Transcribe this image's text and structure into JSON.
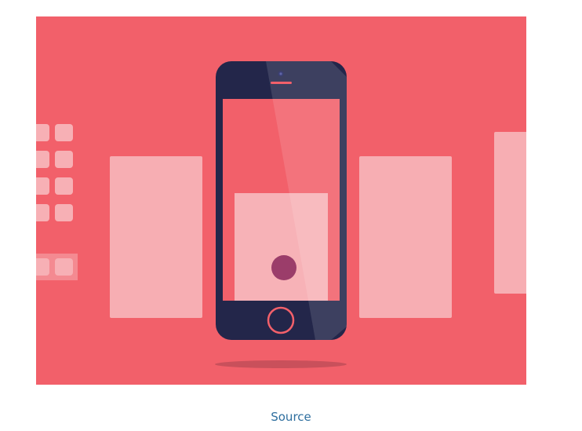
{
  "figure": {
    "colors": {
      "background": "#f2606a",
      "card": "#f7aeb3",
      "phone_body": "#23264a",
      "phone_screen": "#f2606a",
      "home_ring": "#f2606a",
      "touch_dot": "#9b3d6a",
      "shadow": "#c24e58"
    },
    "icon": "phone-swipe-illustration"
  },
  "caption": {
    "link_label": "Source"
  }
}
